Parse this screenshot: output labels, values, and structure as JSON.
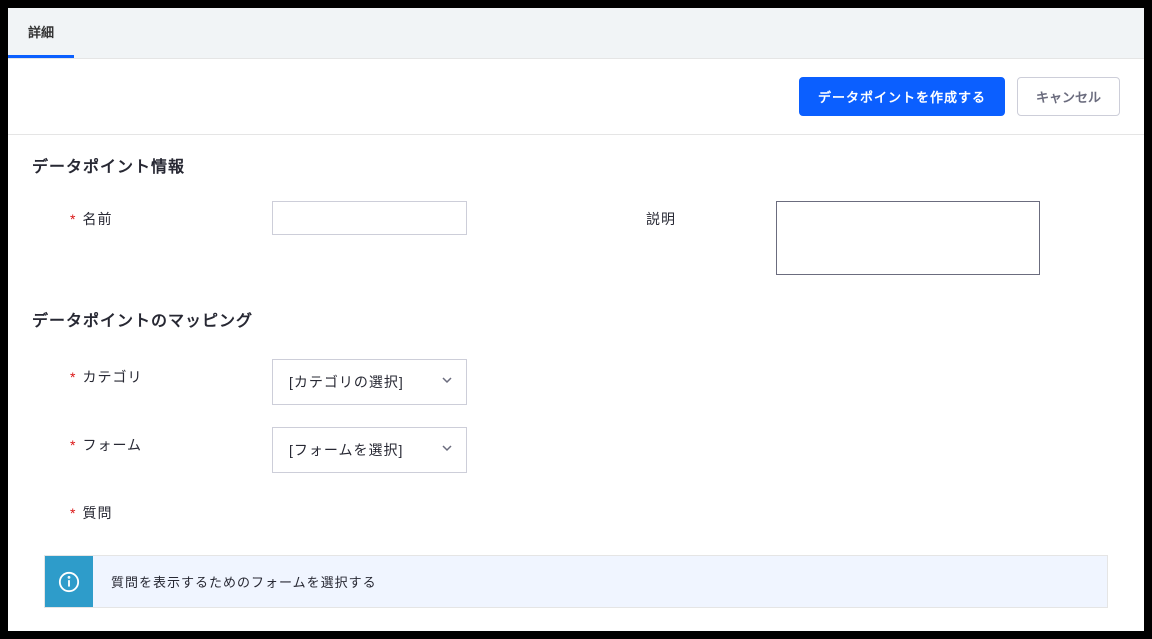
{
  "tabs": {
    "detail": "詳細"
  },
  "actions": {
    "create": "データポイントを作成する",
    "cancel": "キャンセル"
  },
  "sections": {
    "info_title": "データポイント情報",
    "mapping_title": "データポイントのマッピング"
  },
  "fields": {
    "name_label": "名前",
    "description_label": "説明",
    "category_label": "カテゴリ",
    "category_placeholder": "[カテゴリの選択]",
    "form_label": "フォーム",
    "form_placeholder": "[フォームを選択]",
    "question_label": "質問"
  },
  "info": {
    "message": "質問を表示するためのフォームを選択する"
  }
}
